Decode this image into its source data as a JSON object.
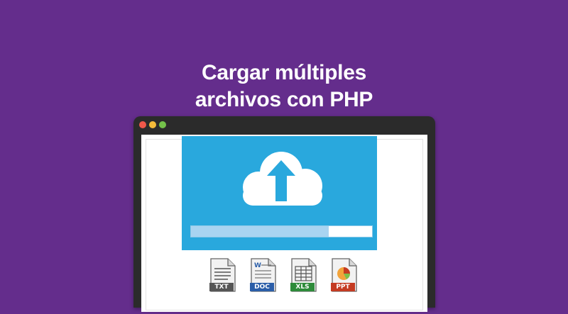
{
  "title": {
    "line1": "Cargar múltiples",
    "line2": "archivos con PHP"
  },
  "window": {
    "controls": [
      "close-dot",
      "minimize-dot",
      "maximize-dot"
    ]
  },
  "upload": {
    "icon": "cloud-upload-icon",
    "progress": 0.76,
    "colors": {
      "panel": "#29a8dd",
      "progress_fill": "#a8d4f1",
      "progress_track": "#ffffff"
    }
  },
  "files": [
    {
      "label": "TXT",
      "icon": "txt-file-icon",
      "color": "#555555"
    },
    {
      "label": "DOC",
      "icon": "doc-file-icon",
      "color": "#2b5ea8"
    },
    {
      "label": "XLS",
      "icon": "xls-file-icon",
      "color": "#2e8b3a"
    },
    {
      "label": "PPT",
      "icon": "ppt-file-icon",
      "color": "#c43b22"
    }
  ],
  "colors": {
    "background": "#642d8c",
    "title": "#ffffff",
    "window_frame": "#2b2b2b"
  }
}
